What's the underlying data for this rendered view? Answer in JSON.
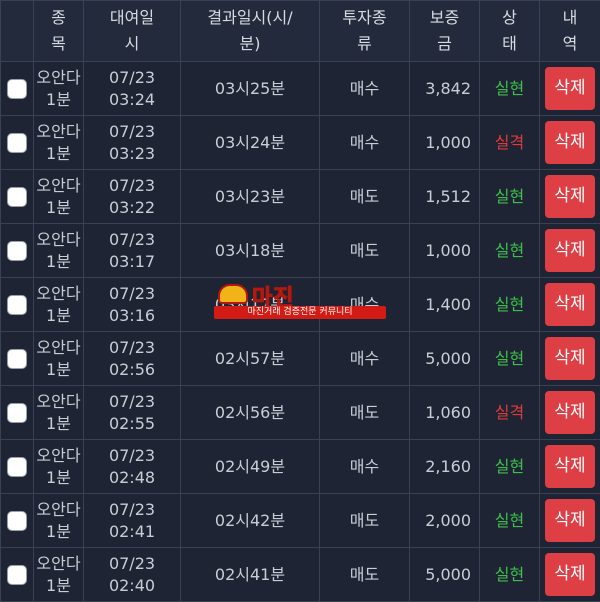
{
  "header": {
    "col_item": "종\n목",
    "col_rent_time": "대여일\n시",
    "col_result_time": "결과일시(시/\n분)",
    "col_type": "투자종\n류",
    "col_deposit": "보증\n금",
    "col_status": "상\n태",
    "col_detail": "내\n역"
  },
  "rows": [
    {
      "item": "오안다\n1분",
      "rent": "07/23\n03:24",
      "result": "03시25분",
      "type": "매수",
      "deposit": "3,842",
      "status": "실현",
      "status_kind": "win",
      "delete": "삭제"
    },
    {
      "item": "오안다\n1분",
      "rent": "07/23\n03:23",
      "result": "03시24분",
      "type": "매수",
      "deposit": "1,000",
      "status": "실격",
      "status_kind": "lose",
      "delete": "삭제"
    },
    {
      "item": "오안다\n1분",
      "rent": "07/23\n03:22",
      "result": "03시23분",
      "type": "매도",
      "deposit": "1,512",
      "status": "실현",
      "status_kind": "win",
      "delete": "삭제"
    },
    {
      "item": "오안다\n1분",
      "rent": "07/23\n03:17",
      "result": "03시18분",
      "type": "매도",
      "deposit": "1,000",
      "status": "실현",
      "status_kind": "win",
      "delete": "삭제"
    },
    {
      "item": "오안다\n1분",
      "rent": "07/23\n03:16",
      "result": "03시17분",
      "type": "매수",
      "deposit": "1,400",
      "status": "실현",
      "status_kind": "win",
      "delete": "삭제"
    },
    {
      "item": "오안다\n1분",
      "rent": "07/23\n02:56",
      "result": "02시57분",
      "type": "매수",
      "deposit": "5,000",
      "status": "실현",
      "status_kind": "win",
      "delete": "삭제"
    },
    {
      "item": "오안다\n1분",
      "rent": "07/23\n02:55",
      "result": "02시56분",
      "type": "매도",
      "deposit": "1,060",
      "status": "실격",
      "status_kind": "lose",
      "delete": "삭제"
    },
    {
      "item": "오안다\n1분",
      "rent": "07/23\n02:48",
      "result": "02시49분",
      "type": "매수",
      "deposit": "2,160",
      "status": "실현",
      "status_kind": "win",
      "delete": "삭제"
    },
    {
      "item": "오안다\n1분",
      "rent": "07/23\n02:41",
      "result": "02시42분",
      "type": "매도",
      "deposit": "2,000",
      "status": "실현",
      "status_kind": "win",
      "delete": "삭제"
    },
    {
      "item": "오안다\n1분",
      "rent": "07/23\n02:40",
      "result": "02시41분",
      "type": "매도",
      "deposit": "5,000",
      "status": "실현",
      "status_kind": "win",
      "delete": "삭제"
    }
  ],
  "watermark": {
    "title": "마진",
    "tag": "마진거래 검증전문 커뮤니티"
  },
  "colors": {
    "background": "#1e2433",
    "win": "#3fbf4b",
    "lose": "#e23b3b",
    "delete_button": "#de3f45"
  }
}
